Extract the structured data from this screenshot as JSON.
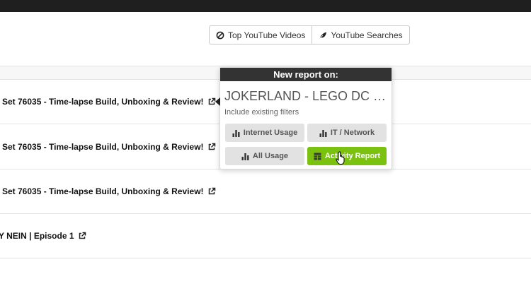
{
  "toolbar": {
    "top_videos_label": "Top YouTube Videos",
    "searches_label": "YouTube Searches"
  },
  "rows": [
    {
      "title": "Set 76035 - Time-lapse Build, Unboxing & Review!"
    },
    {
      "title": "Set 76035 - Time-lapse Build, Unboxing & Review!"
    },
    {
      "title": "Set 76035 - Time-lapse Build, Unboxing & Review!"
    },
    {
      "title": "Y NEIN | Episode 1"
    }
  ],
  "popover": {
    "header": "New report on:",
    "subject": "JOKERLAND - LEGO DC C...",
    "hint": "Include existing filters",
    "buttons": {
      "internet_usage": "Internet Usage",
      "it_network": "IT / Network",
      "all_usage": "All Usage",
      "activity_report": "Activity Report"
    }
  },
  "colors": {
    "accent_green": "#7ac110",
    "header_dark": "#333333",
    "topbar": "#1f1f1f"
  }
}
